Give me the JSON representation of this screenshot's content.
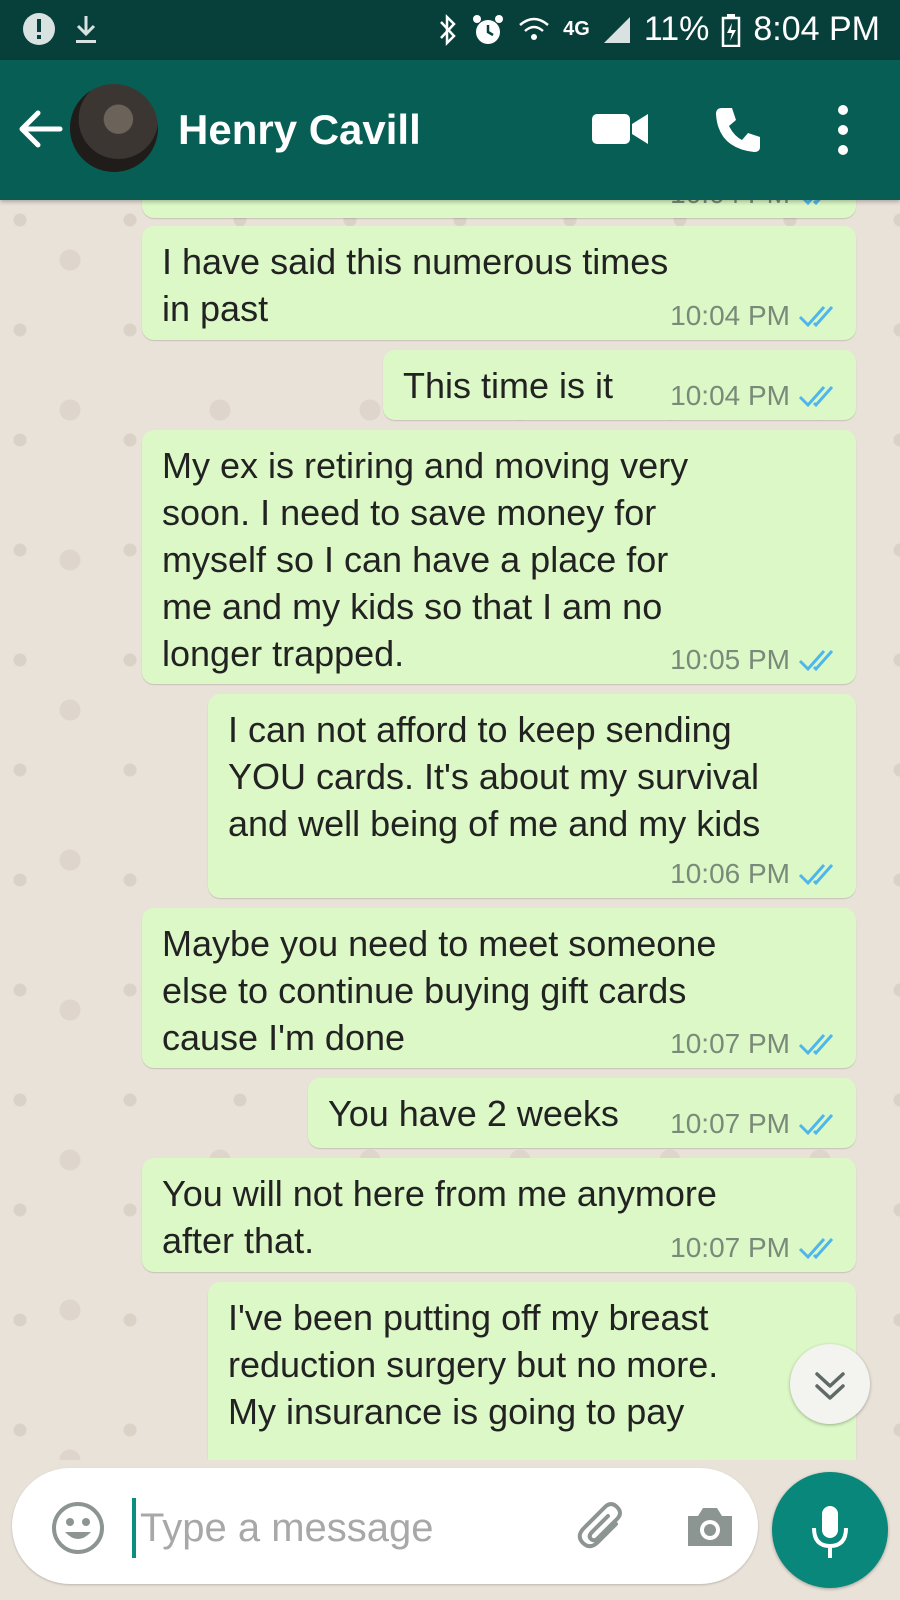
{
  "status_bar": {
    "network": "4G",
    "battery": "11%",
    "time": "8:04 PM"
  },
  "header": {
    "contact_name": "Henry Cavill"
  },
  "messages": [
    {
      "text": "",
      "time": "10:04 PM",
      "partial": true
    },
    {
      "text": "I have said this numerous times\nin past",
      "time": "10:04 PM"
    },
    {
      "text": "This time is it",
      "time": "10:04 PM"
    },
    {
      "text": "My ex is retiring and moving very\nsoon. I need to save money for\nmyself so I can have a place for\nme and my kids so that I am no\nlonger trapped.",
      "time": "10:05 PM"
    },
    {
      "text": "I can not afford to keep sending\nYOU cards. It's about my survival\nand well being of me and my kids",
      "time": "10:06 PM"
    },
    {
      "text": "Maybe you need to meet someone\nelse to continue buying gift cards\ncause I'm done",
      "time": "10:07 PM"
    },
    {
      "text": "You have 2 weeks",
      "time": "10:07 PM"
    },
    {
      "text": "You will not here from me anymore\nafter that.",
      "time": "10:07 PM"
    },
    {
      "text": "I've been putting off my breast\nreduction surgery but no more.\nMy insurance is going to pay",
      "time": "",
      "partial": true
    }
  ],
  "input": {
    "placeholder": "Type a message"
  },
  "colors": {
    "header": "#075e54",
    "status_bar": "#073f3a",
    "outgoing_bubble": "#dcf8c6",
    "read_ticks": "#4fb6ec",
    "mic_button": "#09877a"
  },
  "icons": [
    "back-arrow-icon",
    "video-call-icon",
    "phone-icon",
    "more-options-icon",
    "emoji-icon",
    "attach-icon",
    "camera-icon",
    "mic-icon",
    "chevron-down-icon",
    "double-check-icon"
  ]
}
